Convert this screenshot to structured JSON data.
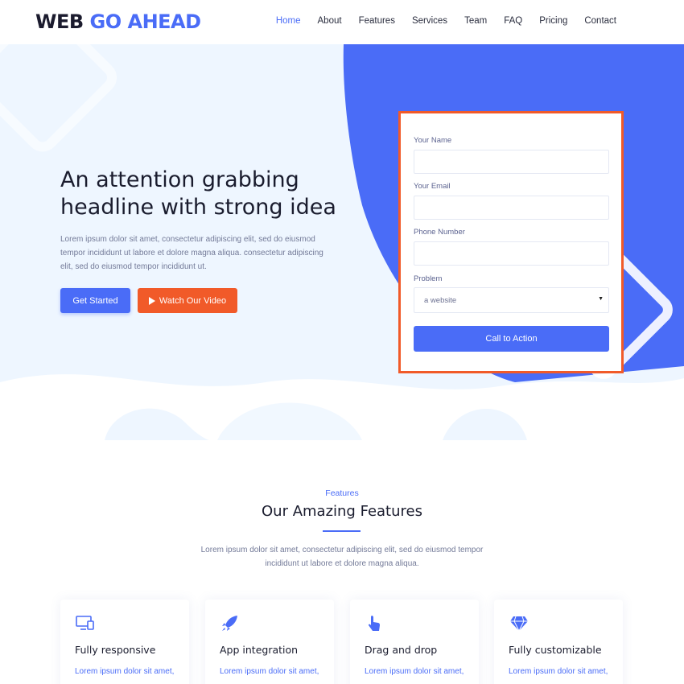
{
  "brand": {
    "part1": "WEB",
    "part2": "GO AHEAD"
  },
  "nav": [
    {
      "label": "Home",
      "active": true
    },
    {
      "label": "About"
    },
    {
      "label": "Features"
    },
    {
      "label": "Services"
    },
    {
      "label": "Team"
    },
    {
      "label": "FAQ"
    },
    {
      "label": "Pricing"
    },
    {
      "label": "Contact"
    }
  ],
  "hero": {
    "title": "An attention grabbing headline with strong idea",
    "text": "Lorem ipsum dolor sit amet, consectetur adipiscing elit, sed do eiusmod tempor incididunt ut labore et dolore magna aliqua. consectetur adipiscing elit, sed do eiusmod tempor incididunt ut.",
    "primary_button": "Get Started",
    "secondary_button": "Watch Our Video"
  },
  "form": {
    "name_label": "Your Name",
    "email_label": "Your Email",
    "phone_label": "Phone Number",
    "problem_label": "Problem",
    "problem_value": "a website",
    "submit": "Call to Action"
  },
  "features": {
    "kicker": "Features",
    "title": "Our Amazing Features",
    "description": "Lorem ipsum dolor sit amet, consectetur adipiscing elit, sed do eiusmod tempor incididunt ut labore et dolore magna aliqua.",
    "cards": [
      {
        "icon": "monitor-icon",
        "title": "Fully responsive",
        "text": "Lorem ipsum dolor sit amet,"
      },
      {
        "icon": "rocket-icon",
        "title": "App integration",
        "text": "Lorem ipsum dolor sit amet,"
      },
      {
        "icon": "hand-pointer-icon",
        "title": "Drag and drop",
        "text": "Lorem ipsum dolor sit amet,"
      },
      {
        "icon": "diamond-icon",
        "title": "Fully customizable",
        "text": "Lorem ipsum dolor sit amet,"
      }
    ]
  },
  "colors": {
    "accent": "#4a6cf7",
    "orange": "#f15a29",
    "hero_bg": "#eef6ff"
  }
}
